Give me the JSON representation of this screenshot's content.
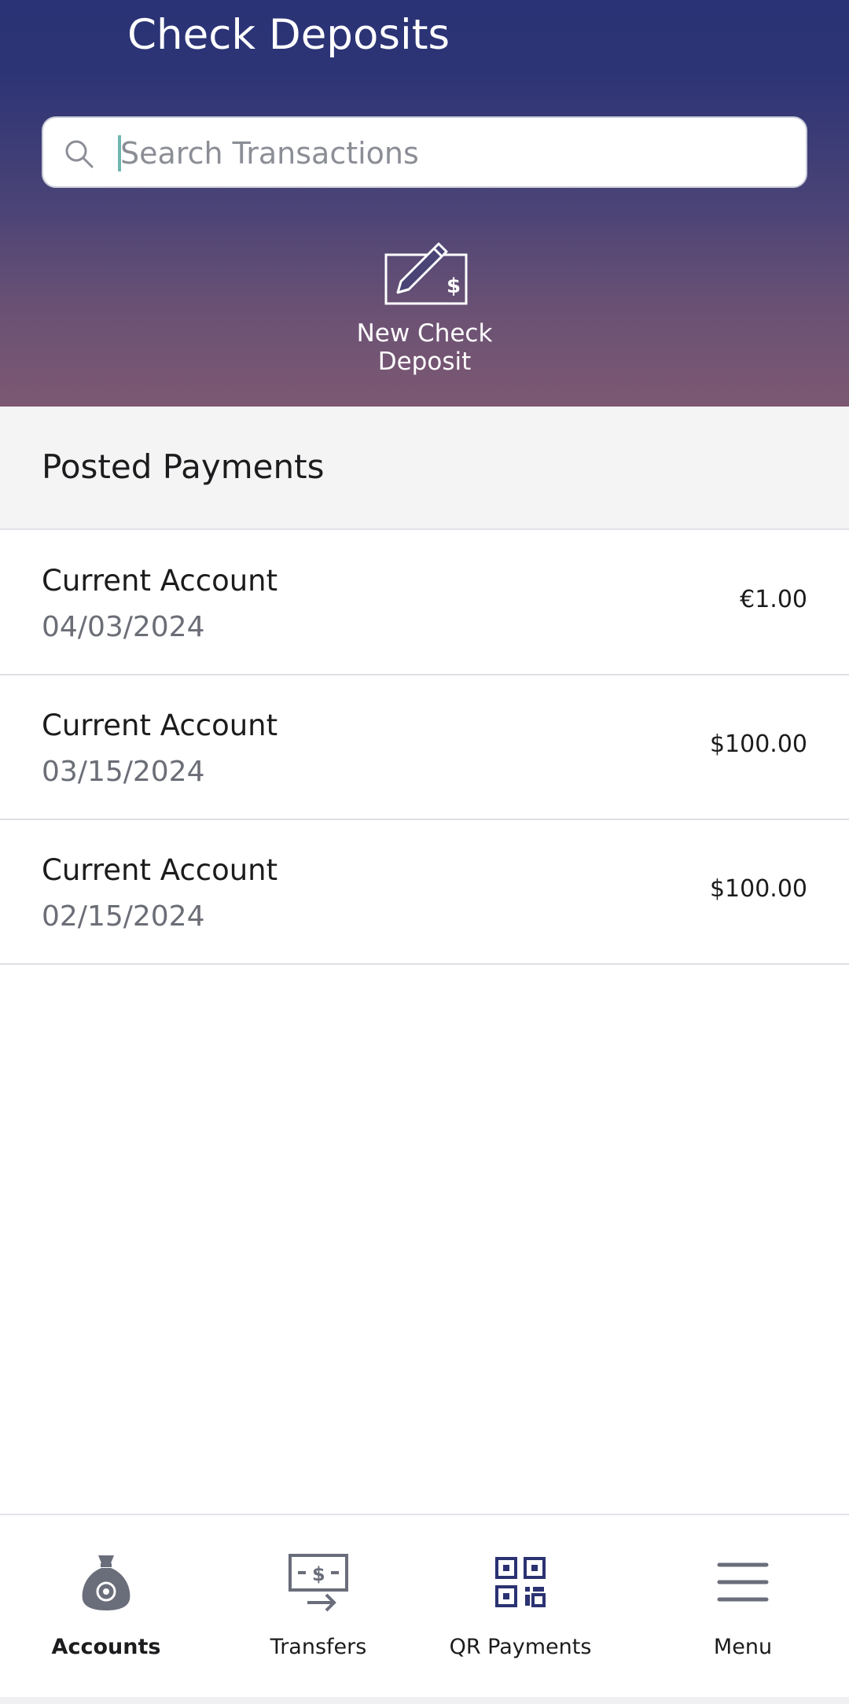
{
  "header": {
    "title": "Check Deposits"
  },
  "search": {
    "placeholder": "Search Transactions",
    "value": ""
  },
  "actions": {
    "new_check_deposit_label": "New Check Deposit"
  },
  "section": {
    "title": "Posted Payments"
  },
  "payments": [
    {
      "account": "Current Account",
      "date": "04/03/2024",
      "amount": "€1.00"
    },
    {
      "account": "Current Account",
      "date": "03/15/2024",
      "amount": "$100.00"
    },
    {
      "account": "Current Account",
      "date": "02/15/2024",
      "amount": "$100.00"
    }
  ],
  "bottom_nav": {
    "items": [
      {
        "label": "Accounts",
        "icon": "money-bag-icon",
        "active": true
      },
      {
        "label": "Transfers",
        "icon": "transfer-icon",
        "active": false
      },
      {
        "label": "QR Payments",
        "icon": "qr-code-icon",
        "active": false
      },
      {
        "label": "Menu",
        "icon": "hamburger-menu-icon",
        "active": false
      }
    ]
  },
  "colors": {
    "header_top": "#2a3375",
    "header_bottom": "#7c5872",
    "accent_caret": "#6fb6b0",
    "icon_gray": "#6a6d7a",
    "qr_icon": "#2b3272"
  }
}
